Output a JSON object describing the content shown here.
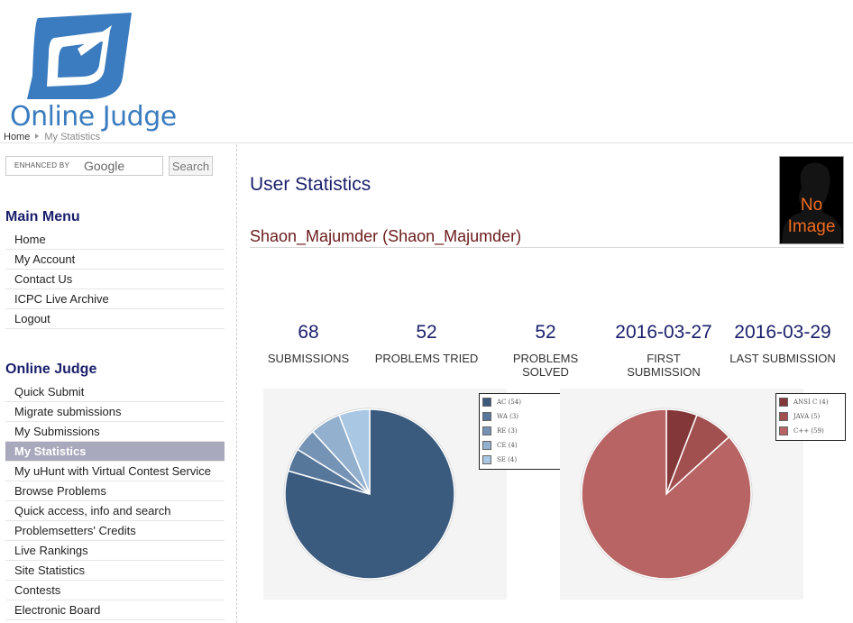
{
  "site": {
    "logo_text": "Online Judge"
  },
  "breadcrumb": {
    "home": "Home",
    "current": "My Statistics"
  },
  "search": {
    "enhanced_by": "ENHANCED BY",
    "google": "Google",
    "button": "Search"
  },
  "main_menu": {
    "title": "Main Menu",
    "items": [
      "Home",
      "My Account",
      "Contact Us",
      "ICPC Live Archive",
      "Logout"
    ]
  },
  "oj_menu": {
    "title": "Online Judge",
    "active": "My Statistics",
    "items": [
      "Quick Submit",
      "Migrate submissions",
      "My Submissions",
      "My Statistics",
      "My uHunt with Virtual Contest Service",
      "Browse Problems",
      "Quick access, info and search",
      "Problemsetters' Credits",
      "Live Rankings",
      "Site Statistics",
      "Contests",
      "Electronic Board"
    ]
  },
  "page": {
    "title": "User Statistics",
    "user": "Shaon_Majumder (Shaon_Majumder)",
    "avatar_text_1": "No",
    "avatar_text_2": "Image"
  },
  "stats": [
    {
      "value": "68",
      "label1": "SUBMISSIONS",
      "label2": ""
    },
    {
      "value": "52",
      "label1": "PROBLEMS TRIED",
      "label2": ""
    },
    {
      "value": "52",
      "label1": "PROBLEMS",
      "label2": "SOLVED"
    },
    {
      "value": "2016-03-27",
      "label1": "FIRST",
      "label2": "SUBMISSION"
    },
    {
      "value": "2016-03-29",
      "label1": "LAST SUBMISSION",
      "label2": ""
    }
  ],
  "chart_data": [
    {
      "type": "pie",
      "title": "",
      "categories": [
        "AC (54)",
        "WA (3)",
        "RE (3)",
        "CE (4)",
        "SE (4)"
      ],
      "values": [
        54,
        3,
        3,
        4,
        4
      ],
      "colors": [
        "#3a5a7e",
        "#56769a",
        "#7593b4",
        "#93b1cf",
        "#a9c6e3"
      ],
      "legend": "top-right"
    },
    {
      "type": "pie",
      "title": "",
      "categories": [
        "ANSI C (4)",
        "JAVA (5)",
        "C++ (59)"
      ],
      "values": [
        4,
        5,
        59
      ],
      "colors": [
        "#843738",
        "#a24f50",
        "#b86465"
      ],
      "legend": "top-right"
    }
  ]
}
